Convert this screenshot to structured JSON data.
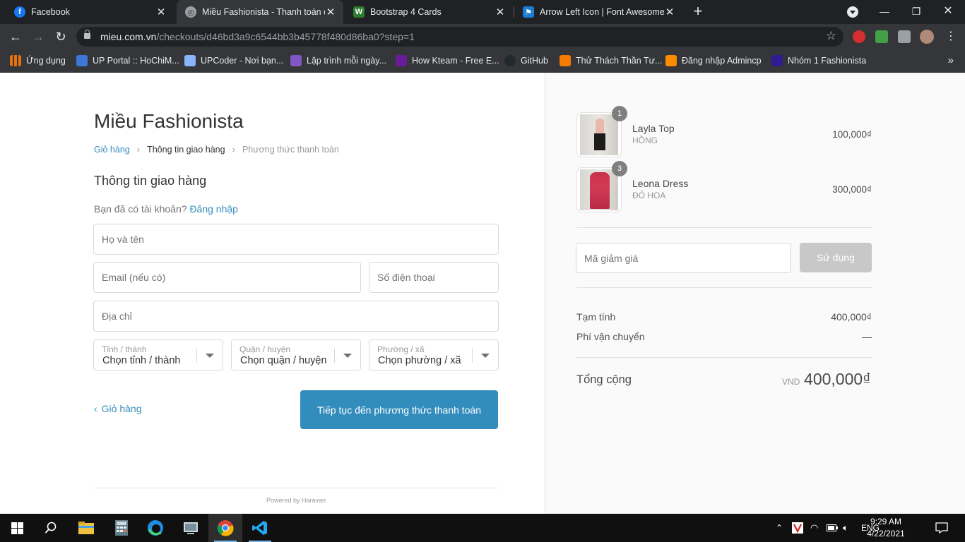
{
  "browser": {
    "tabs": [
      {
        "title": "Facebook",
        "color": "#1877f2",
        "glyph": "f"
      },
      {
        "title": "Miều Fashionista - Thanh toán đơ",
        "color": "#9aa0a6",
        "glyph": "◎"
      },
      {
        "title": "Bootstrap 4 Cards",
        "color": "#35363a",
        "glyph": "W"
      },
      {
        "title": "Arrow Left Icon | Font Awesome",
        "color": "#1c7cd6",
        "glyph": "⚑"
      }
    ],
    "url_host": "mieu.com.vn",
    "url_path": "/checkouts/d46bd3a9c6544bb3b45778f480d86ba0?step=1",
    "bookmarks": [
      {
        "label": "Ứng dụng",
        "color": "#e8710a"
      },
      {
        "label": "UP Portal :: HoChiM...",
        "color": "#3c78d8"
      },
      {
        "label": "UPCoder - Nơi bạn...",
        "color": "#8ab4f8"
      },
      {
        "label": "Lập trình mỗi ngày...",
        "color": "#7e57c2"
      },
      {
        "label": "How Kteam - Free E...",
        "color": "#6a1b9a"
      },
      {
        "label": "GitHub",
        "color": "#24292e"
      },
      {
        "label": "Thử Thách Thần Tư...",
        "color": "#f57c00"
      },
      {
        "label": "Đăng nhập Admincp",
        "color": "#fb8c00"
      },
      {
        "label": "Nhóm 1 Fashionista",
        "color": "#311b92"
      }
    ]
  },
  "checkout": {
    "shop_name": "Miều Fashionista",
    "breadcrumb": {
      "cart": "Giỏ hàng",
      "shipping": "Thông tin giao hàng",
      "payment": "Phương thức thanh toán"
    },
    "section_title": "Thông tin giao hàng",
    "login_prompt": "Bạn đã có tài khoản?",
    "login_link": "Đăng nhập",
    "fields": {
      "fullname_placeholder": "Họ và tên",
      "email_placeholder": "Email (nếu có)",
      "phone_placeholder": "Số điện thoại",
      "address_placeholder": "Địa chỉ"
    },
    "selects": {
      "province_label": "Tỉnh / thành",
      "province_value": "Chọn tỉnh / thành",
      "district_label": "Quận / huyện",
      "district_value": "Chọn quận / huyện",
      "ward_label": "Phường / xã",
      "ward_value": "Chọn phường / xã"
    },
    "back_label": "Giỏ hàng",
    "continue_label": "Tiếp tục đến phương thức thanh toán",
    "powered_by": "Powered by Haravan"
  },
  "order": {
    "items": [
      {
        "name": "Layla Top",
        "variant": "HỒNG",
        "price": "100,000₫",
        "qty": "1"
      },
      {
        "name": "Leona Dress",
        "variant": "ĐỎ HOA",
        "price": "300,000₫",
        "qty": "3"
      }
    ],
    "discount_placeholder": "Mã giảm giá",
    "apply_label": "Sử dụng",
    "subtotal_label": "Tạm tính",
    "subtotal_value": "400,000₫",
    "shipping_label": "Phí vận chuyển",
    "shipping_value": "—",
    "total_label": "Tổng cộng",
    "total_currency": "VND",
    "total_value": "400,000₫"
  },
  "taskbar": {
    "language": "ENG",
    "time": "9:29 AM",
    "date": "4/22/2021"
  }
}
